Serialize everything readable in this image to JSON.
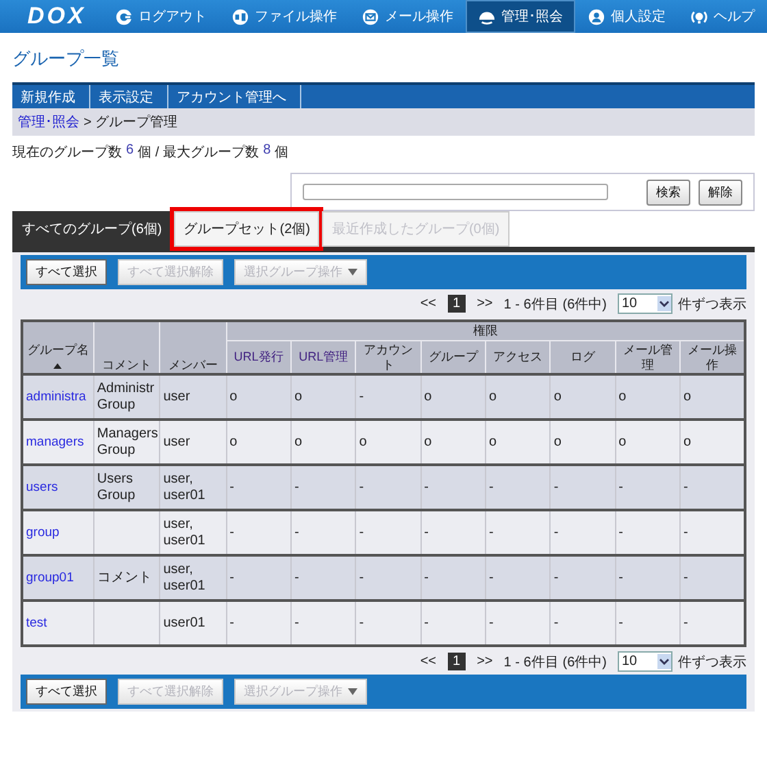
{
  "header": {
    "logo": "DOX",
    "nav": [
      {
        "label": "ログアウト",
        "selected": false
      },
      {
        "label": "ファイル操作",
        "selected": false
      },
      {
        "label": "メール操作",
        "selected": false
      },
      {
        "label": "管理･照会",
        "selected": true
      },
      {
        "label": "個人設定",
        "selected": false
      },
      {
        "label": "ヘルプ",
        "selected": false
      }
    ]
  },
  "page_title": "グループ一覧",
  "menu": [
    "新規作成",
    "表示設定",
    "アカウント管理へ"
  ],
  "breadcrumb": {
    "link": "管理･照会",
    "current": "> グループ管理"
  },
  "summary": {
    "current_label": "現在のグループ数",
    "current": "6",
    "unit1": "個 /",
    "max_label": "最大グループ数",
    "max": "8",
    "unit2": "個"
  },
  "search": {
    "buttons": [
      "検索",
      "解除"
    ]
  },
  "tabs": [
    {
      "label": "すべてのグループ(6個)",
      "selected": true,
      "disabled": false,
      "highlighted": false
    },
    {
      "label": "グループセット(2個)",
      "selected": false,
      "disabled": false,
      "highlighted": true
    },
    {
      "label": "最近作成したグループ(0個)",
      "selected": false,
      "disabled": true,
      "highlighted": false
    }
  ],
  "toolbar_top": [
    {
      "label": "すべて選択",
      "disabled": false,
      "kind": "button"
    },
    {
      "label": "すべて選択解除",
      "disabled": true,
      "kind": "button"
    },
    {
      "label": "選択グループ操作",
      "disabled": true,
      "kind": "dropdown"
    }
  ],
  "pagination_top": {
    "prev": "<<",
    "page": "1",
    "next": ">>",
    "range": "1 - 6件目",
    "total": "(6件中)",
    "per_page": "10",
    "per_page_label": "件ずつ表示"
  },
  "table": {
    "group_header": "権限",
    "columns": [
      "グループ名",
      "コメント",
      "メンバー",
      "URL発行",
      "URL管理",
      "アカウント",
      "グループ",
      "アクセス",
      "ログ",
      "メール管理",
      "メール操作"
    ],
    "rows": [
      [
        "administra",
        "Administr Group",
        "user",
        "o",
        "o",
        "-",
        "o",
        "o",
        "o",
        "o",
        "o"
      ],
      [
        "managers",
        "Managers Group",
        "user",
        "o",
        "o",
        "o",
        "o",
        "o",
        "o",
        "o",
        "o"
      ],
      [
        "users",
        "Users Group",
        "user, user01",
        "-",
        "-",
        "-",
        "-",
        "-",
        "-",
        "-",
        "-"
      ],
      [
        "group",
        "",
        "user, user01",
        "-",
        "-",
        "-",
        "-",
        "-",
        "-",
        "-",
        "-"
      ],
      [
        "group01",
        "コメント",
        "user, user01",
        "-",
        "-",
        "-",
        "-",
        "-",
        "-",
        "-",
        "-"
      ],
      [
        "test",
        "",
        "user01",
        "-",
        "-",
        "-",
        "-",
        "-",
        "-",
        "-",
        "-"
      ]
    ]
  },
  "pagination_bottom": {
    "prev": "<<",
    "page": "1",
    "next": ">>",
    "range": "1 - 6件目",
    "total": "(6件中)",
    "per_page": "10",
    "per_page_label": "件ずつ表示"
  },
  "toolbar_bottom": [
    {
      "label": "すべて選択",
      "disabled": false,
      "kind": "button"
    },
    {
      "label": "すべて選択解除",
      "disabled": true,
      "kind": "button"
    },
    {
      "label": "選択グループ操作",
      "disabled": true,
      "kind": "dropdown"
    }
  ]
}
